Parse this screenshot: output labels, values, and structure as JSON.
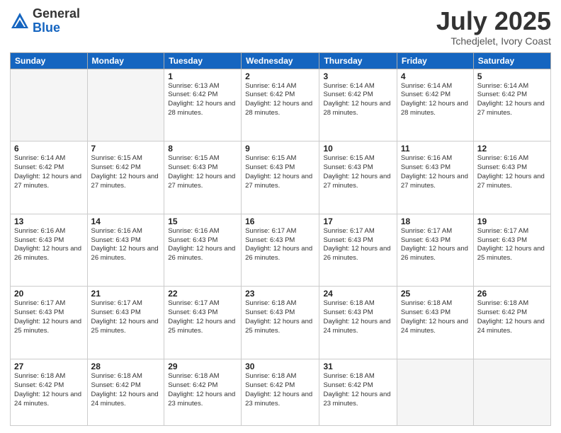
{
  "logo": {
    "general": "General",
    "blue": "Blue"
  },
  "header": {
    "month_year": "July 2025",
    "location": "Tchedjelet, Ivory Coast"
  },
  "days_of_week": [
    "Sunday",
    "Monday",
    "Tuesday",
    "Wednesday",
    "Thursday",
    "Friday",
    "Saturday"
  ],
  "weeks": [
    [
      {
        "day": "",
        "info": ""
      },
      {
        "day": "",
        "info": ""
      },
      {
        "day": "1",
        "info": "Sunrise: 6:13 AM\nSunset: 6:42 PM\nDaylight: 12 hours and 28 minutes."
      },
      {
        "day": "2",
        "info": "Sunrise: 6:14 AM\nSunset: 6:42 PM\nDaylight: 12 hours and 28 minutes."
      },
      {
        "day": "3",
        "info": "Sunrise: 6:14 AM\nSunset: 6:42 PM\nDaylight: 12 hours and 28 minutes."
      },
      {
        "day": "4",
        "info": "Sunrise: 6:14 AM\nSunset: 6:42 PM\nDaylight: 12 hours and 28 minutes."
      },
      {
        "day": "5",
        "info": "Sunrise: 6:14 AM\nSunset: 6:42 PM\nDaylight: 12 hours and 27 minutes."
      }
    ],
    [
      {
        "day": "6",
        "info": "Sunrise: 6:14 AM\nSunset: 6:42 PM\nDaylight: 12 hours and 27 minutes."
      },
      {
        "day": "7",
        "info": "Sunrise: 6:15 AM\nSunset: 6:42 PM\nDaylight: 12 hours and 27 minutes."
      },
      {
        "day": "8",
        "info": "Sunrise: 6:15 AM\nSunset: 6:43 PM\nDaylight: 12 hours and 27 minutes."
      },
      {
        "day": "9",
        "info": "Sunrise: 6:15 AM\nSunset: 6:43 PM\nDaylight: 12 hours and 27 minutes."
      },
      {
        "day": "10",
        "info": "Sunrise: 6:15 AM\nSunset: 6:43 PM\nDaylight: 12 hours and 27 minutes."
      },
      {
        "day": "11",
        "info": "Sunrise: 6:16 AM\nSunset: 6:43 PM\nDaylight: 12 hours and 27 minutes."
      },
      {
        "day": "12",
        "info": "Sunrise: 6:16 AM\nSunset: 6:43 PM\nDaylight: 12 hours and 27 minutes."
      }
    ],
    [
      {
        "day": "13",
        "info": "Sunrise: 6:16 AM\nSunset: 6:43 PM\nDaylight: 12 hours and 26 minutes."
      },
      {
        "day": "14",
        "info": "Sunrise: 6:16 AM\nSunset: 6:43 PM\nDaylight: 12 hours and 26 minutes."
      },
      {
        "day": "15",
        "info": "Sunrise: 6:16 AM\nSunset: 6:43 PM\nDaylight: 12 hours and 26 minutes."
      },
      {
        "day": "16",
        "info": "Sunrise: 6:17 AM\nSunset: 6:43 PM\nDaylight: 12 hours and 26 minutes."
      },
      {
        "day": "17",
        "info": "Sunrise: 6:17 AM\nSunset: 6:43 PM\nDaylight: 12 hours and 26 minutes."
      },
      {
        "day": "18",
        "info": "Sunrise: 6:17 AM\nSunset: 6:43 PM\nDaylight: 12 hours and 26 minutes."
      },
      {
        "day": "19",
        "info": "Sunrise: 6:17 AM\nSunset: 6:43 PM\nDaylight: 12 hours and 25 minutes."
      }
    ],
    [
      {
        "day": "20",
        "info": "Sunrise: 6:17 AM\nSunset: 6:43 PM\nDaylight: 12 hours and 25 minutes."
      },
      {
        "day": "21",
        "info": "Sunrise: 6:17 AM\nSunset: 6:43 PM\nDaylight: 12 hours and 25 minutes."
      },
      {
        "day": "22",
        "info": "Sunrise: 6:17 AM\nSunset: 6:43 PM\nDaylight: 12 hours and 25 minutes."
      },
      {
        "day": "23",
        "info": "Sunrise: 6:18 AM\nSunset: 6:43 PM\nDaylight: 12 hours and 25 minutes."
      },
      {
        "day": "24",
        "info": "Sunrise: 6:18 AM\nSunset: 6:43 PM\nDaylight: 12 hours and 24 minutes."
      },
      {
        "day": "25",
        "info": "Sunrise: 6:18 AM\nSunset: 6:43 PM\nDaylight: 12 hours and 24 minutes."
      },
      {
        "day": "26",
        "info": "Sunrise: 6:18 AM\nSunset: 6:42 PM\nDaylight: 12 hours and 24 minutes."
      }
    ],
    [
      {
        "day": "27",
        "info": "Sunrise: 6:18 AM\nSunset: 6:42 PM\nDaylight: 12 hours and 24 minutes."
      },
      {
        "day": "28",
        "info": "Sunrise: 6:18 AM\nSunset: 6:42 PM\nDaylight: 12 hours and 24 minutes."
      },
      {
        "day": "29",
        "info": "Sunrise: 6:18 AM\nSunset: 6:42 PM\nDaylight: 12 hours and 23 minutes."
      },
      {
        "day": "30",
        "info": "Sunrise: 6:18 AM\nSunset: 6:42 PM\nDaylight: 12 hours and 23 minutes."
      },
      {
        "day": "31",
        "info": "Sunrise: 6:18 AM\nSunset: 6:42 PM\nDaylight: 12 hours and 23 minutes."
      },
      {
        "day": "",
        "info": ""
      },
      {
        "day": "",
        "info": ""
      }
    ]
  ]
}
